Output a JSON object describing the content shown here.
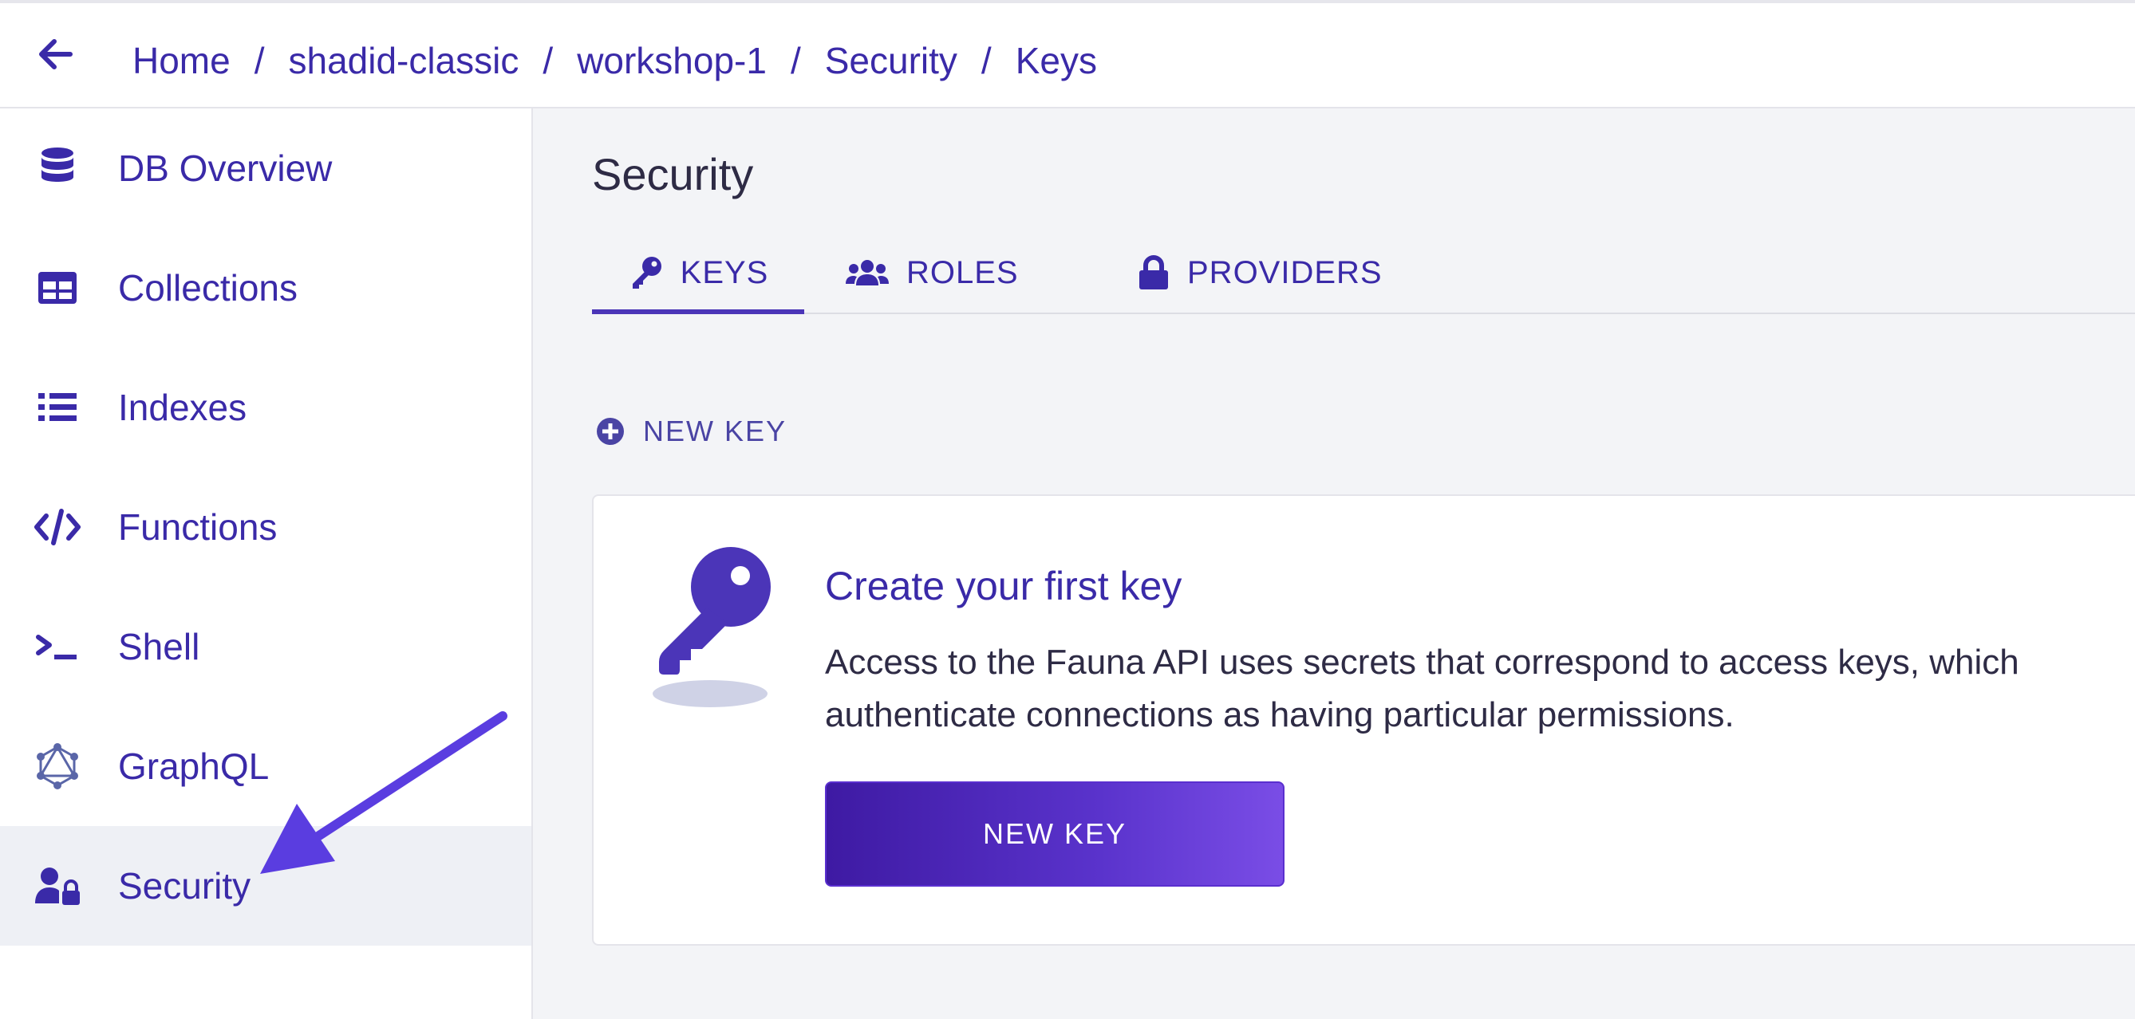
{
  "breadcrumb": {
    "items": [
      "Home",
      "shadid-classic",
      "workshop-1",
      "Security",
      "Keys"
    ],
    "separator": "/"
  },
  "sidebar": {
    "items": [
      {
        "label": "DB Overview",
        "icon": "database-icon"
      },
      {
        "label": "Collections",
        "icon": "table-icon"
      },
      {
        "label": "Indexes",
        "icon": "list-icon"
      },
      {
        "label": "Functions",
        "icon": "code-icon"
      },
      {
        "label": "Shell",
        "icon": "terminal-icon"
      },
      {
        "label": "GraphQL",
        "icon": "graphql-icon"
      },
      {
        "label": "Security",
        "icon": "user-lock-icon",
        "active": true
      }
    ]
  },
  "main": {
    "title": "Security",
    "tabs": [
      {
        "label": "KEYS",
        "icon": "key-icon",
        "active": true
      },
      {
        "label": "ROLES",
        "icon": "users-icon"
      },
      {
        "label": "PROVIDERS",
        "icon": "lock-icon"
      }
    ],
    "new_key_link": "NEW KEY",
    "empty_state": {
      "title": "Create your first key",
      "description": "Access to the Fauna API uses secrets that correspond to access keys, which authenticate connections as having particular permissions.",
      "button": "NEW KEY"
    }
  },
  "colors": {
    "accent": "#3a2aa8",
    "button_gradient_start": "#3e1aa3",
    "button_gradient_end": "#7a4de6",
    "annotation_arrow": "#5a3de0",
    "active_background": "#eef0f5"
  }
}
